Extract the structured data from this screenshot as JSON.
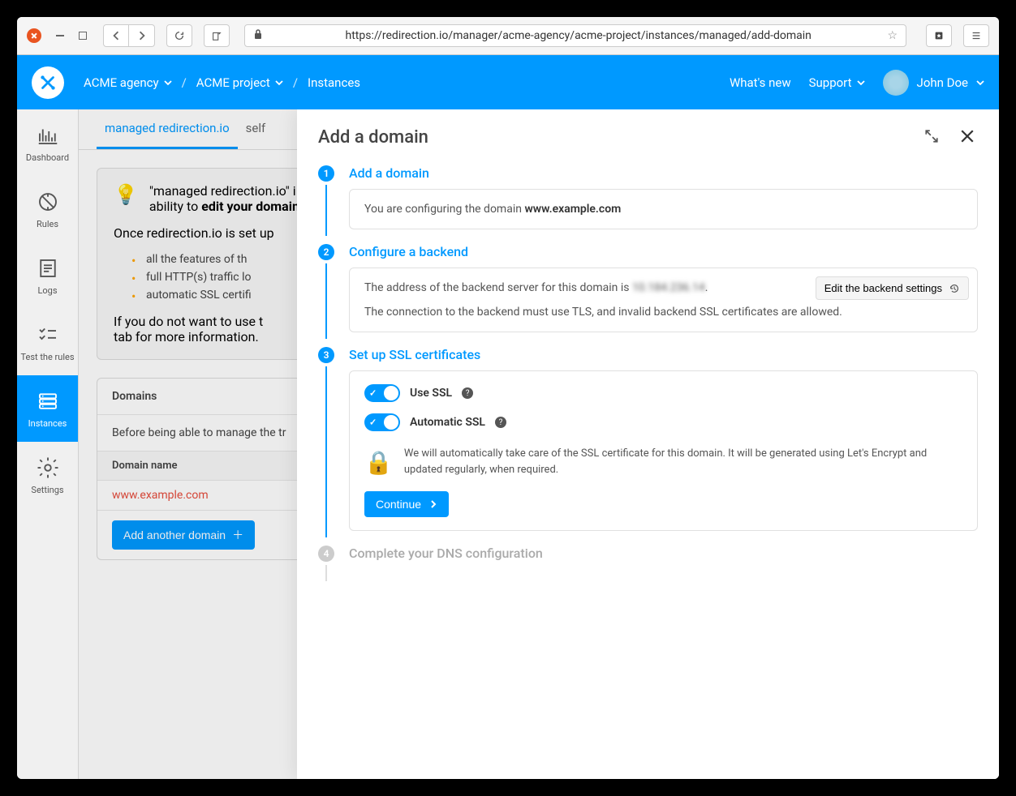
{
  "browser": {
    "url": "https://redirection.io/manager/acme-agency/acme-project/instances/managed/add-domain"
  },
  "header": {
    "breadcrumb": [
      "ACME agency",
      "ACME project",
      "Instances"
    ],
    "whats_new": "What's new",
    "support": "Support",
    "user_name": "John Doe"
  },
  "sidebar": {
    "items": [
      {
        "label": "Dashboard"
      },
      {
        "label": "Rules"
      },
      {
        "label": "Logs"
      },
      {
        "label": "Test the rules"
      },
      {
        "label": "Instances"
      },
      {
        "label": "Settings"
      }
    ]
  },
  "tabs": {
    "active": "managed redirection.io",
    "other": "self"
  },
  "info": {
    "line1_prefix": "\"managed redirection.io\" i",
    "line1_bold": "edit your domain",
    "line2": "Once redirection.io is set up",
    "bullets": [
      "all the features of th",
      "full HTTP(s) traffic lo",
      "automatic SSL certifi"
    ],
    "line3": "If you do not want to use t",
    "line4": "tab for more information."
  },
  "domains_section": {
    "heading": "Domains",
    "text": "Before being able to manage the tr",
    "col": "Domain name",
    "row": "www.example.com",
    "add_btn": "Add another domain"
  },
  "drawer": {
    "title": "Add a domain",
    "steps": [
      {
        "num": "1",
        "title": "Add a domain"
      },
      {
        "num": "2",
        "title": "Configure a backend"
      },
      {
        "num": "3",
        "title": "Set up SSL certificates"
      },
      {
        "num": "4",
        "title": "Complete your DNS configuration"
      }
    ],
    "step1": {
      "text": "You are configuring the domain ",
      "domain": "www.example.com"
    },
    "step2": {
      "line1": "The address of the backend server for this domain is ",
      "ip": "10.184.236.14",
      "line2": "The connection to the backend must use TLS, and invalid backend SSL certificates are allowed.",
      "edit_btn": "Edit the backend settings"
    },
    "step3": {
      "toggle1": "Use SSL",
      "toggle2": "Automatic SSL",
      "info": "We will automatically take care of the SSL certificate for this domain. It will be generated using Let's Encrypt and updated regularly, when required.",
      "continue": "Continue"
    }
  }
}
